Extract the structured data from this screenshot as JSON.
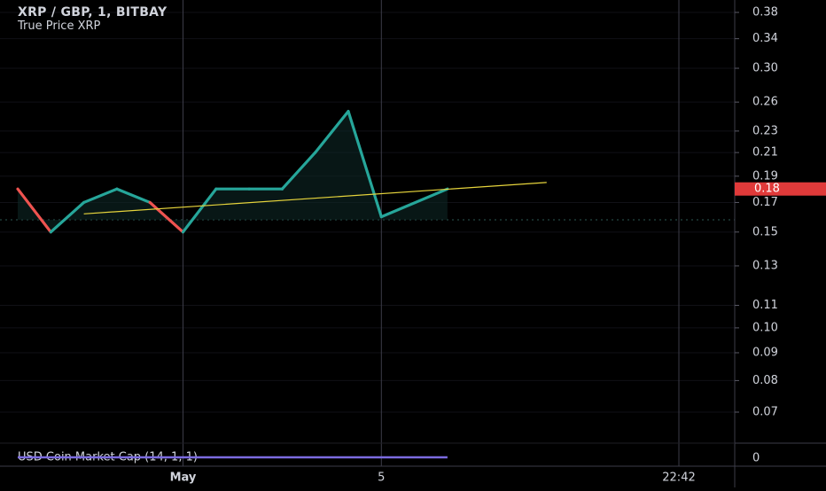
{
  "header": {
    "symbol_line": "XRP / GBP, 1, BITBAY",
    "indicator_line": "True Price XRP"
  },
  "price_axis": {
    "ticks": [
      "0.38",
      "0.34",
      "0.30",
      "0.26",
      "0.23",
      "0.21",
      "0.19",
      "0.17",
      "0.15",
      "0.13",
      "0.11",
      "0.10",
      "0.09",
      "0.08",
      "0.07"
    ],
    "current_price_label": "0.18"
  },
  "time_axis": {
    "labels": [
      "May",
      "5",
      "22:42"
    ]
  },
  "lower_pane": {
    "indicator_label": "USD Coin Market Cap (14, 1, 1)",
    "axis_value": "0"
  },
  "colors": {
    "background": "#000000",
    "grid": "#2a2a33",
    "vertical_grid": "#3c3c48",
    "up_line": "#26a69a",
    "down_line": "#ef5350",
    "trend_line": "#e6d43c",
    "area_fill": "#0e2a28",
    "price_tag_bg": "#e03a3a",
    "dotted_line": "#2d5a54",
    "indicator_line": "#7b6be0",
    "text": "#d1d4dc"
  },
  "chart_data": {
    "type": "line",
    "title": "XRP / GBP, 1, BITBAY",
    "subtitle": "True Price XRP",
    "scale": "log",
    "ylim": [
      0.065,
      0.4
    ],
    "yticks": [
      0.38,
      0.34,
      0.3,
      0.26,
      0.23,
      0.21,
      0.19,
      0.17,
      0.15,
      0.13,
      0.11,
      0.1,
      0.09,
      0.08,
      0.07
    ],
    "series": [
      {
        "kind": "price",
        "points": [
          {
            "t": 0,
            "v": 0.18
          },
          {
            "t": 1,
            "v": 0.15
          },
          {
            "t": 2,
            "v": 0.17
          },
          {
            "t": 3,
            "v": 0.18
          },
          {
            "t": 4,
            "v": 0.17
          },
          {
            "t": 5,
            "v": 0.15
          },
          {
            "t": 6,
            "v": 0.18
          },
          {
            "t": 7,
            "v": 0.18
          },
          {
            "t": 8,
            "v": 0.18
          },
          {
            "t": 9,
            "v": 0.21
          },
          {
            "t": 10,
            "v": 0.25
          },
          {
            "t": 11,
            "v": 0.16
          },
          {
            "t": 13,
            "v": 0.18
          }
        ]
      },
      {
        "kind": "trend",
        "points": [
          {
            "t": 2,
            "v": 0.162
          },
          {
            "t": 16,
            "v": 0.185
          }
        ]
      }
    ],
    "current_price": 0.18,
    "dotted_reference": 0.158,
    "time_labels": [
      {
        "t": 5,
        "label": "May"
      },
      {
        "t": 11,
        "label": "5"
      },
      {
        "t": 20,
        "label": "22:42"
      }
    ],
    "vertical_gridlines_t": [
      5,
      11,
      20
    ]
  }
}
